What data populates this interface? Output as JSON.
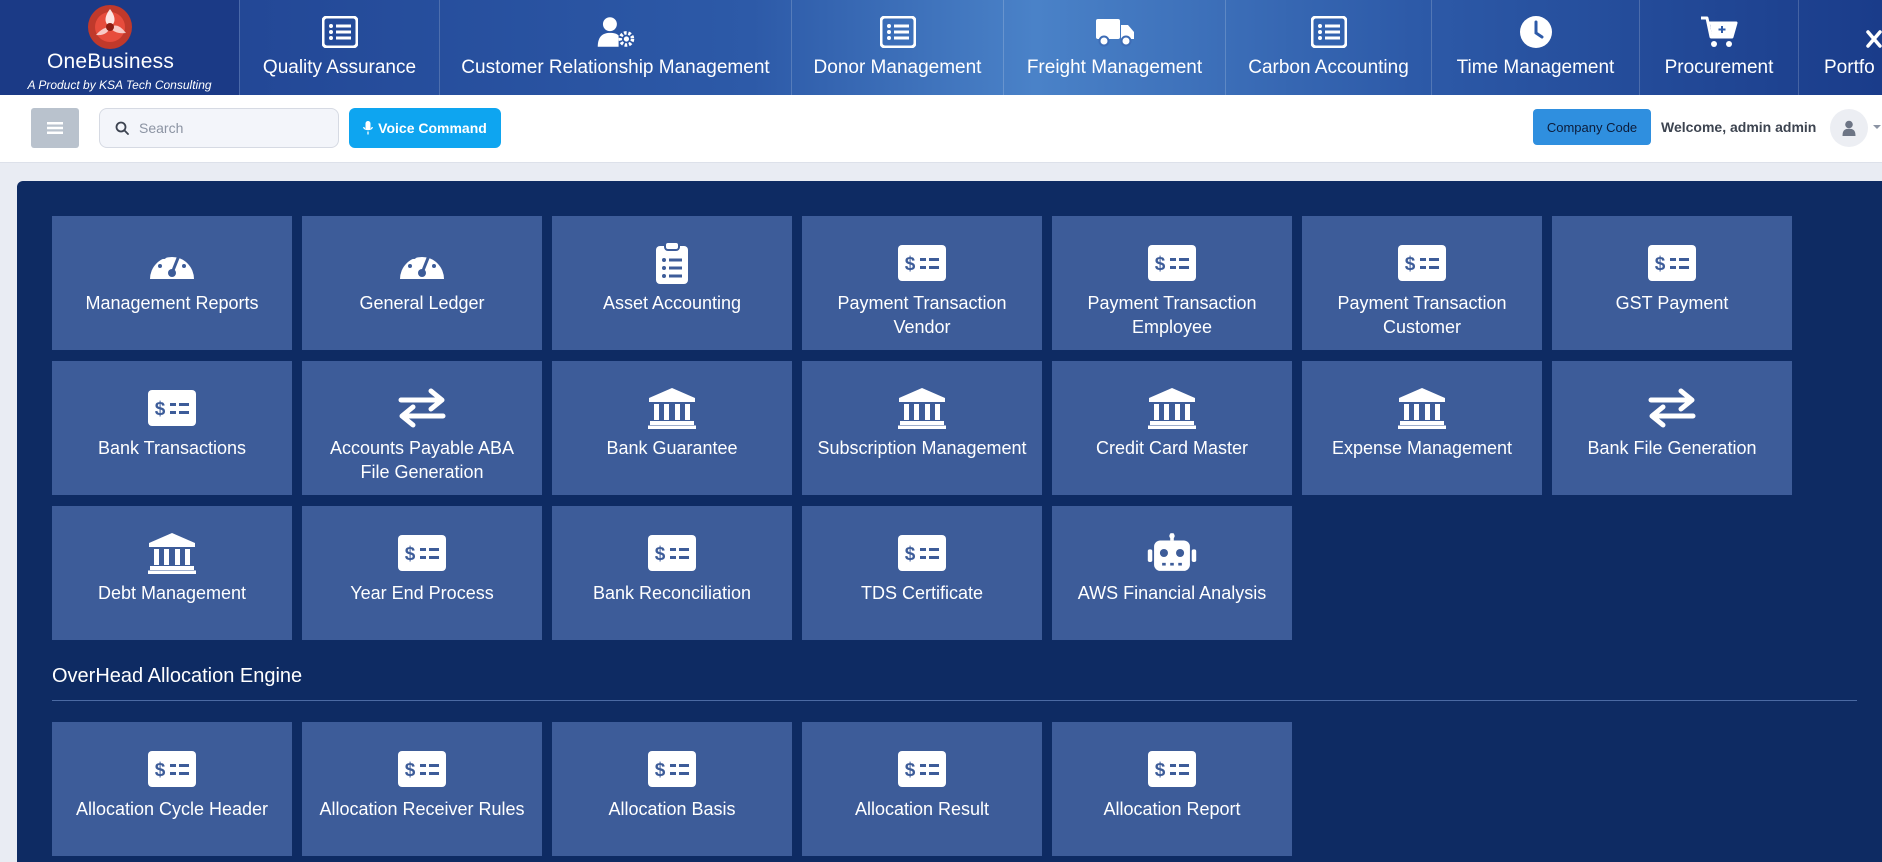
{
  "brand": {
    "name": "OneBusiness",
    "tagline": "A Product by KSA Tech Consulting"
  },
  "modules": [
    {
      "label": "Quality Assurance",
      "icon": "list-icon"
    },
    {
      "label": "Customer Relationship Management",
      "icon": "user-gear-icon"
    },
    {
      "label": "Donor Management",
      "icon": "list-icon"
    },
    {
      "label": "Freight Management",
      "icon": "truck-icon"
    },
    {
      "label": "Carbon Accounting",
      "icon": "list-icon"
    },
    {
      "label": "Time Management",
      "icon": "clock-icon"
    },
    {
      "label": "Procurement",
      "icon": "cart-icon"
    },
    {
      "label": "Portfo",
      "icon": "briefcase-icon"
    }
  ],
  "toolbar": {
    "search_placeholder": "Search",
    "voice_label": "Voice Command",
    "company_label": "Company Code",
    "welcome_text": "Welcome, admin admin"
  },
  "tiles": [
    {
      "label": "Management Reports",
      "icon": "gauge-icon"
    },
    {
      "label": "General Ledger",
      "icon": "gauge-icon"
    },
    {
      "label": "Asset Accounting",
      "icon": "clipboard-icon"
    },
    {
      "label": "Payment Transaction Vendor",
      "icon": "money-bill-icon"
    },
    {
      "label": "Payment Transaction Employee",
      "icon": "money-bill-icon"
    },
    {
      "label": "Payment Transaction Customer",
      "icon": "money-bill-icon"
    },
    {
      "label": "GST Payment",
      "icon": "money-bill-icon"
    },
    {
      "label": "Bank Transactions",
      "icon": "money-bill-icon"
    },
    {
      "label": "Accounts Payable ABA File Generation",
      "icon": "exchange-icon"
    },
    {
      "label": "Bank Guarantee",
      "icon": "bank-icon"
    },
    {
      "label": "Subscription Management",
      "icon": "bank-icon"
    },
    {
      "label": "Credit Card Master",
      "icon": "bank-icon"
    },
    {
      "label": "Expense Management",
      "icon": "bank-icon"
    },
    {
      "label": "Bank File Generation",
      "icon": "exchange-icon"
    },
    {
      "label": "Debt Management",
      "icon": "bank-icon"
    },
    {
      "label": "Year End Process",
      "icon": "money-bill-icon"
    },
    {
      "label": "Bank Reconciliation",
      "icon": "money-bill-icon"
    },
    {
      "label": "TDS Certificate",
      "icon": "money-bill-icon"
    },
    {
      "label": "AWS Financial Analysis",
      "icon": "robot-icon"
    }
  ],
  "overhead": {
    "title": "OverHead Allocation Engine",
    "tiles": [
      {
        "label": "Allocation Cycle Header",
        "icon": "money-bill-icon"
      },
      {
        "label": "Allocation Receiver Rules",
        "icon": "money-bill-icon"
      },
      {
        "label": "Allocation Basis",
        "icon": "money-bill-icon"
      },
      {
        "label": "Allocation Result",
        "icon": "money-bill-icon"
      },
      {
        "label": "Allocation Report",
        "icon": "money-bill-icon"
      }
    ]
  },
  "colors": {
    "panel": "#0e2b63",
    "tile": "#3d5c99",
    "voice_button": "#0ea5f0",
    "company_button": "#2f8fdf"
  }
}
